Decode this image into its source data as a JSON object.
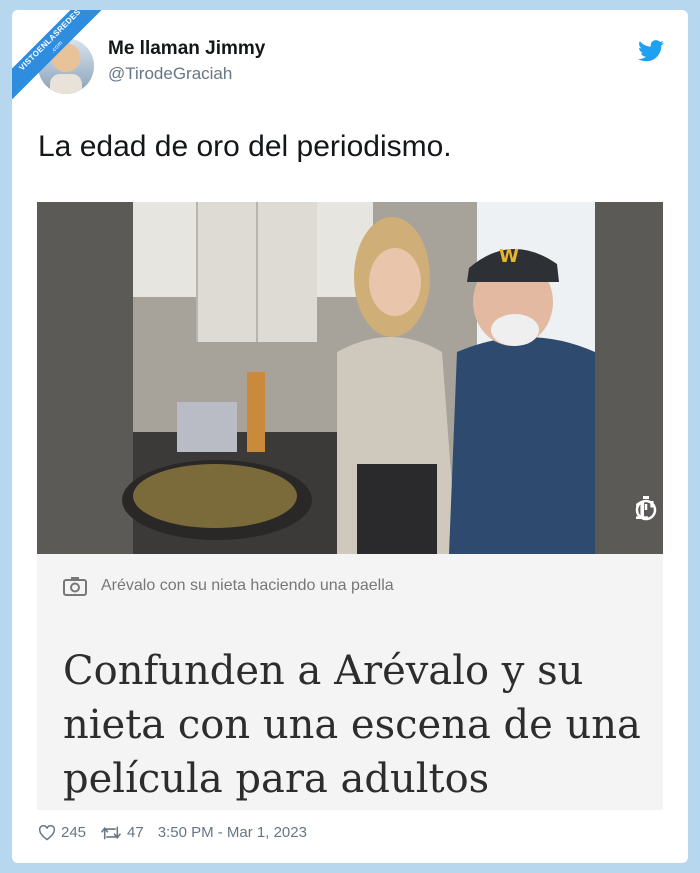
{
  "watermark": {
    "text": "VISTOENLASREDES",
    "sub": ".com"
  },
  "author": {
    "name": "Me llaman Jimmy",
    "handle": "@TirodeGraciah"
  },
  "tweet": {
    "text": "La edad de oro del periodismo."
  },
  "media": {
    "duration": "1'",
    "caption": "Arévalo con su nieta haciendo una paella"
  },
  "article": {
    "headline": "Confunden a Arévalo y su nieta con una escena de una película para adultos"
  },
  "stats": {
    "likes": "245",
    "retweets": "47",
    "timestamp": "3:50 PM - Mar 1, 2023"
  },
  "icons": {
    "brand": "twitter-bird-icon",
    "camera": "camera-icon",
    "stopwatch": "stopwatch-icon",
    "like": "heart-icon",
    "retweet": "retweet-icon"
  },
  "colors": {
    "twitter_blue": "#1da1f2",
    "page_bg": "#b6d7ee",
    "muted_text": "#657786"
  }
}
